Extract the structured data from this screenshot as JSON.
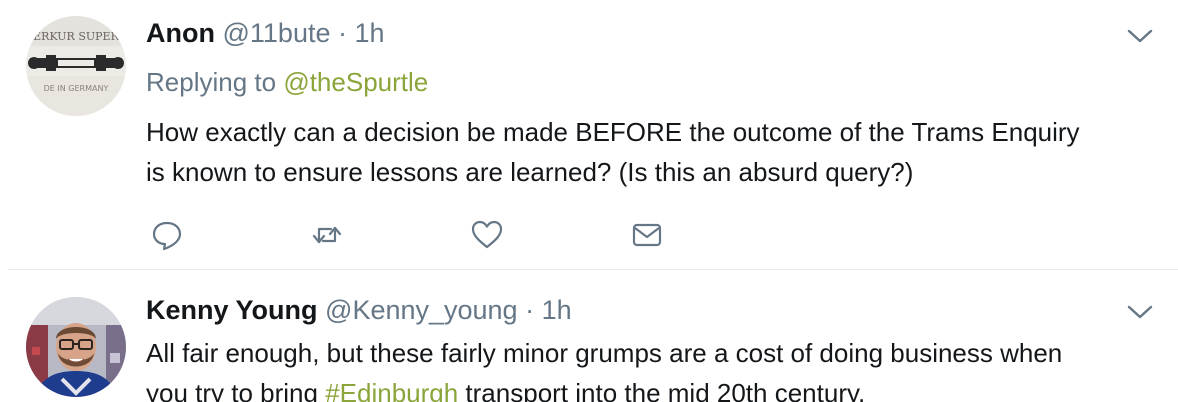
{
  "colors": {
    "link": "#8ba53a",
    "secondary_text": "#657786",
    "primary_text": "#14171a",
    "divider": "#e6ecf0",
    "icon": "#657786"
  },
  "tweets": [
    {
      "name": "Anon",
      "handle": "@11bute",
      "separator": "·",
      "time": "1h",
      "replying_prefix": "Replying to",
      "replying_to": "@theSpurtle",
      "text_lines": [
        "How exactly can a decision be made BEFORE the outcome of the Trams Enquiry",
        "is known to ensure lessons are learned? (Is this an absurd query?)"
      ],
      "avatar_text": {
        "top": "ERKUR SUPER",
        "bottom": "DE IN GERMANY"
      },
      "actions": [
        "reply-icon",
        "retweet-icon",
        "like-icon",
        "direct-message-icon"
      ],
      "menu_icon": "chevron-down-icon"
    },
    {
      "name": "Kenny Young",
      "handle": "@Kenny_young",
      "separator": "·",
      "time": "1h",
      "text_before": "All fair enough, but these fairly minor grumps are a cost of doing business when",
      "text_line2_before": "you try to bring ",
      "hashtag": "#Edinburgh",
      "text_line2_after": " transport into the mid 20th century.",
      "menu_icon": "chevron-down-icon"
    }
  ]
}
